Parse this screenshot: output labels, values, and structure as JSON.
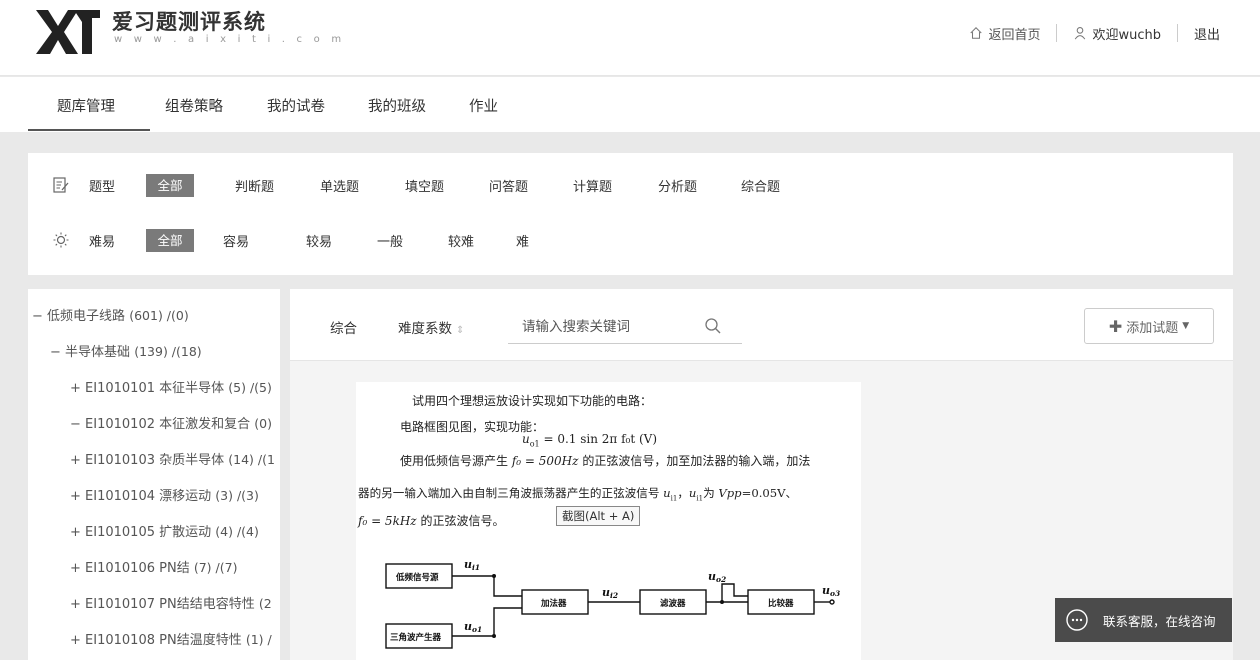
{
  "brand": {
    "name": "爱习题测评系统",
    "url": "w w w . a i x i t i . c o m"
  },
  "header": {
    "home": "返回首页",
    "welcome": "欢迎wuchb",
    "logout": "退出"
  },
  "nav": {
    "items": [
      "题库管理",
      "组卷策略",
      "我的试卷",
      "我的班级",
      "作业"
    ],
    "active_index": 0
  },
  "filters": {
    "type": {
      "label": "题型",
      "active": "全部",
      "options": [
        "判断题",
        "单选题",
        "填空题",
        "问答题",
        "计算题",
        "分析题",
        "综合题"
      ]
    },
    "difficulty": {
      "label": "难易",
      "active": "全部",
      "options": [
        "容易",
        "较易",
        "一般",
        "较难",
        "难"
      ]
    }
  },
  "tree": [
    {
      "prefix": "−",
      "label": "低频电子线路",
      "count": "(601) /(0)"
    },
    {
      "prefix": "−",
      "label": "半导体基础",
      "count": "(139) /(18)"
    },
    {
      "prefix": "+",
      "label": "EI1010101 本征半导体",
      "count": "(5) /(5)"
    },
    {
      "prefix": "−",
      "label": "EI1010102 本征激发和复合",
      "count": "(0)"
    },
    {
      "prefix": "+",
      "label": "EI1010103 杂质半导体",
      "count": "(14) /(1"
    },
    {
      "prefix": "+",
      "label": "EI1010104 漂移运动",
      "count": "(3) /(3)"
    },
    {
      "prefix": "+",
      "label": "EI1010105 扩散运动",
      "count": "(4) /(4)"
    },
    {
      "prefix": "+",
      "label": "EI1010106 PN结",
      "count": "(7) /(7)"
    },
    {
      "prefix": "+",
      "label": "EI1010107 PN结结电容特性",
      "count": "(2"
    },
    {
      "prefix": "+",
      "label": "EI1010108 PN结温度特性",
      "count": "(1) /"
    }
  ],
  "toolbar": {
    "comprehensive": "综合",
    "difficulty_coef": "难度系数",
    "search_placeholder": "请输入搜索关键词",
    "add_button": "添加试题"
  },
  "question": {
    "line1": "试用四个理想运放设计实现如下功能的电路：",
    "line2": "电路框图见图，实现功能：",
    "formula1": "u",
    "formula1_sub": "o1",
    "formula1_rest": " = 0.1 sin 2π f₀t (V)",
    "line3a": "使用低频信号源产生",
    "line3_formula": "f₀ = 500Hz",
    "line3b": "的正弦波信号，加至加法器的输入端，加法",
    "line4a": "器的另一输入端加入由自制三角波振荡器产生的正弦波信号",
    "line4_var": "u",
    "line4_var_sub": "i1",
    "line4b": "，",
    "line4_var2": "u",
    "line4_var2_sub": "i1",
    "line4c": "为",
    "line4_vpp": "Vpp",
    "line4d": "=0.05V、",
    "line5_formula": "f₀ = 5kHz",
    "line5": "的正弦波信号。",
    "tooltip": "截图(Alt + A)",
    "diagram": {
      "box1": "低频信号源",
      "box2": "三角波产生器",
      "adder": "加法器",
      "filter": "滤波器",
      "comparator": "比较器",
      "label_ui1": "u",
      "label_ui1_sub": "i1",
      "label_uo1": "u",
      "label_uo1_sub": "o1",
      "label_ui2": "u",
      "label_ui2_sub": "i2",
      "label_uo2": "u",
      "label_uo2_sub": "o2",
      "label_uo3": "u",
      "label_uo3_sub": "o3"
    }
  },
  "contact": "联系客服，在线咨询"
}
